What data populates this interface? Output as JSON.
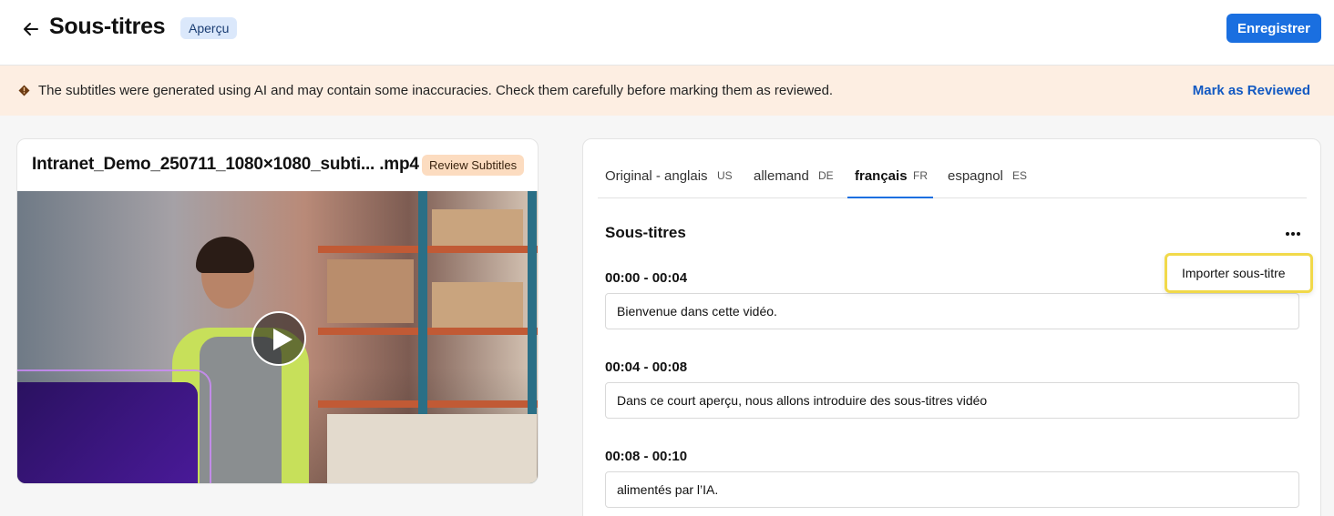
{
  "header": {
    "title": "Sous-titres",
    "badge": "Aperçu",
    "save_label": "Enregistrer"
  },
  "banner": {
    "message": "The subtitles were generated using AI and may contain some inaccuracies. Check them carefully before marking them as reviewed.",
    "action_label": "Mark as Reviewed"
  },
  "video": {
    "filename": "Intranet_Demo_250711_1080×1080_subti... .mp4",
    "status_badge": "Review Subtitles"
  },
  "tabs": [
    {
      "label": "Original - anglais",
      "code": "US",
      "active": false
    },
    {
      "label": "allemand",
      "code": "DE",
      "active": false
    },
    {
      "label": "français",
      "code": "FR",
      "active": true
    },
    {
      "label": "espagnol",
      "code": "ES",
      "active": false
    }
  ],
  "subtitles": {
    "section_title": "Sous-titres",
    "menu_item": "Importer sous-titre",
    "cues": [
      {
        "time": "00:00 - 00:04",
        "text": "Bienvenue dans cette vidéo."
      },
      {
        "time": "00:04 - 00:08",
        "text": "Dans ce court aperçu, nous allons introduire des sous-titres vidéo"
      },
      {
        "time": "00:08 - 00:10",
        "text": "alimentés par l’IA."
      }
    ]
  },
  "colors": {
    "primary": "#1a6fe0",
    "banner_bg": "#fdeee2",
    "highlight": "#f1d94a",
    "review_badge": "#fcdcc0",
    "preview_badge": "#dbe8fb"
  },
  "icons": [
    "arrow-left-icon",
    "warning-icon",
    "play-icon",
    "more-horizontal-icon"
  ]
}
